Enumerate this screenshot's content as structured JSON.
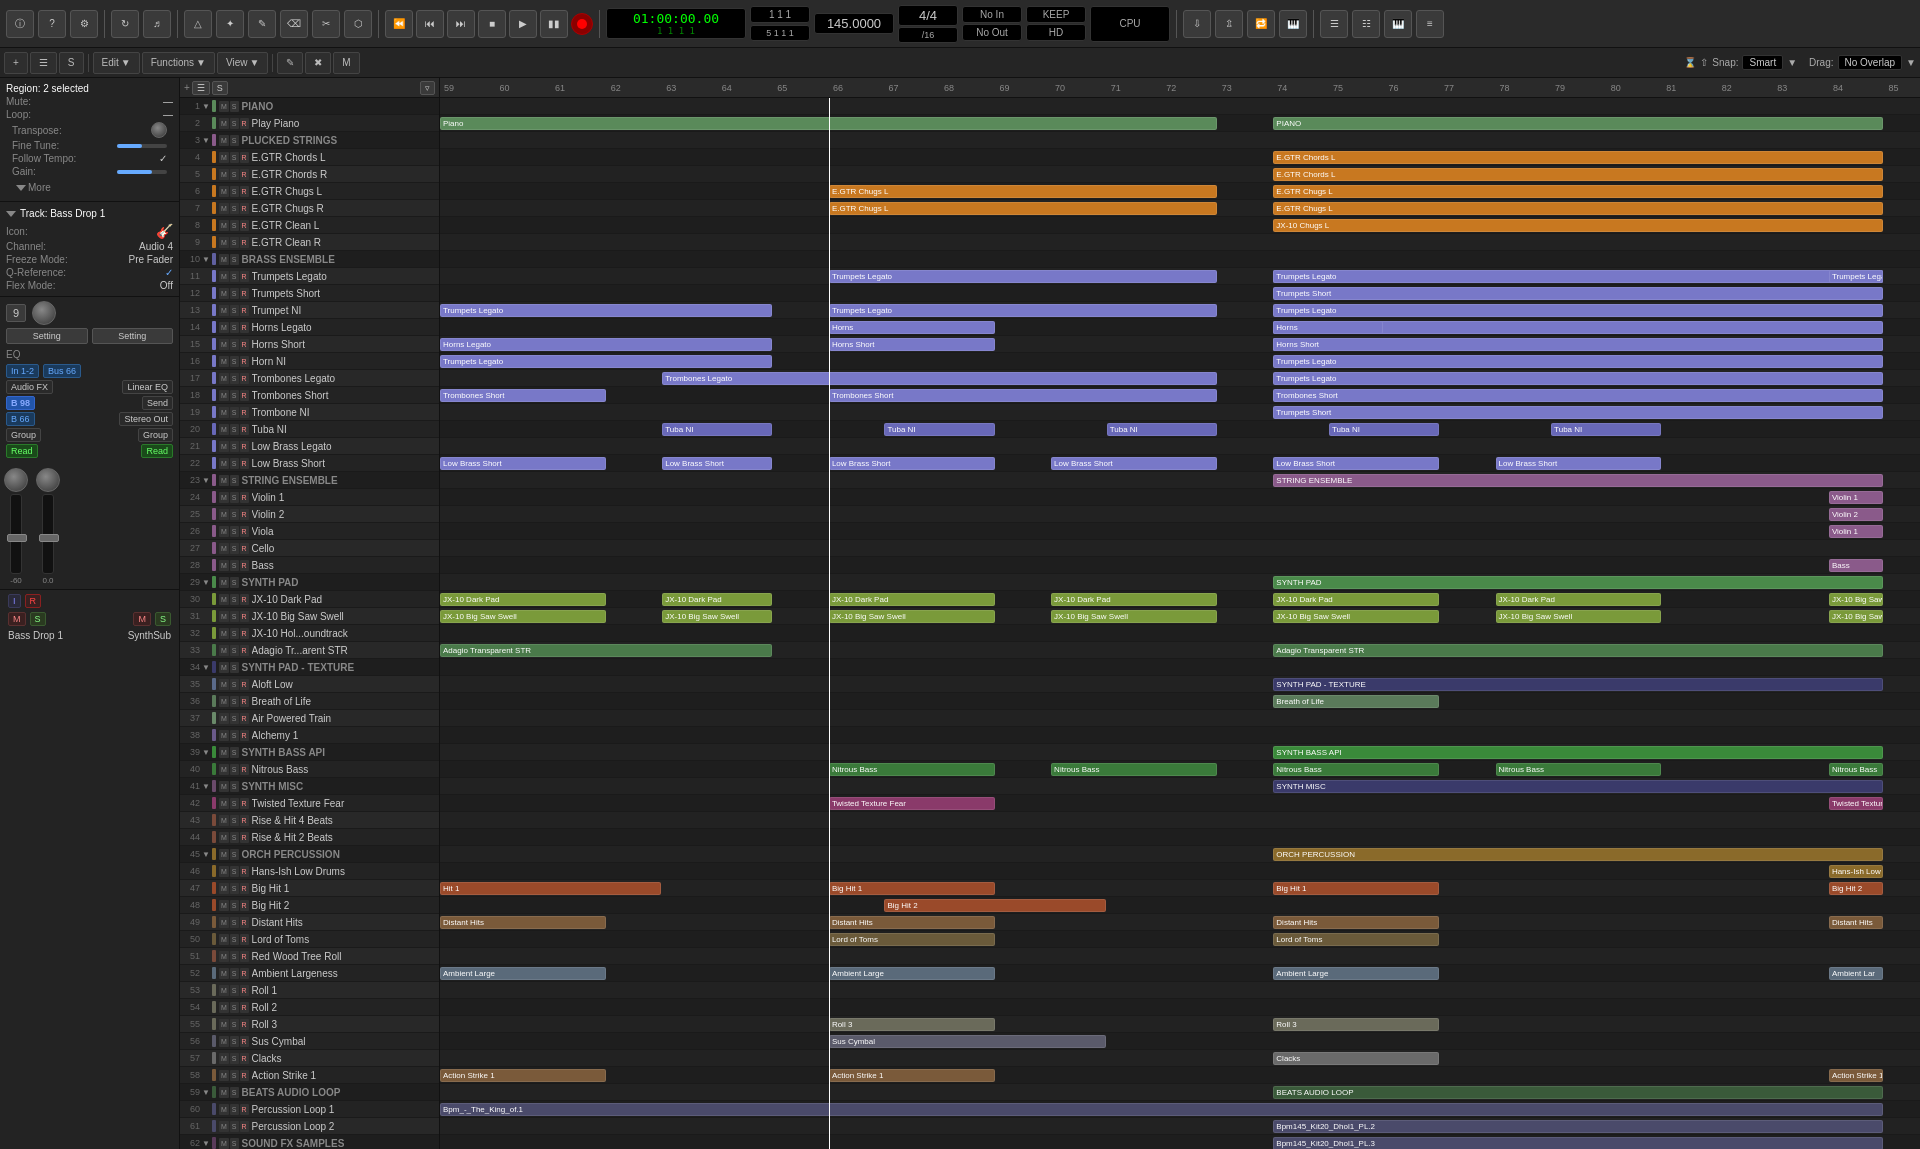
{
  "toolbar": {
    "time": "01:00:00.00",
    "time_sub": "1  1  1  1",
    "beats": "1  1  1",
    "beats_sub": "5  1  1  1",
    "tempo": "145.0000",
    "sig": "4/4",
    "division": "/16",
    "no_in": "No In",
    "no_out": "No Out",
    "keep": "KEEP",
    "hd": "HD",
    "cpu": "CPU",
    "buttons": [
      "info",
      "help",
      "config",
      "loop",
      "metronome",
      "cursor",
      "smart",
      "pen",
      "eraser",
      "cut",
      "glue",
      "select",
      "zoom",
      "fade"
    ],
    "transport": [
      "rewind",
      "back",
      "forward",
      "stop",
      "play",
      "pause",
      "record"
    ]
  },
  "edit_toolbar": {
    "edit": "Edit",
    "functions": "Functions",
    "view": "View",
    "snap": "Snap:",
    "snap_val": "Smart",
    "drag": "Drag:",
    "drag_val": "No Overlap"
  },
  "left_panel": {
    "region_label": "Region: 2 selected",
    "mute": "Mute:",
    "loop": "Loop:",
    "transpose": "Transpose:",
    "fine_tune": "Fine Tune:",
    "follow_tempo": "Follow Tempo:",
    "gain": "Gain:",
    "more": "More",
    "track_label": "Track: Bass Drop 1",
    "icon_label": "guitar",
    "channel": "Channel: Audio 4",
    "freeze_mode": "Freeze Mode: Pre Fader",
    "q_reference": "Q-Reference:",
    "flex_mode": "Flex Mode: Off",
    "channel_num": "9",
    "setting1": "Setting",
    "setting2": "Setting",
    "eq": "EQ",
    "in_bus": "In 1-2",
    "bus_num": "Bus 66",
    "audio_fx": "Audio FX",
    "linear_eq": "Linear EQ",
    "b_num": "B 98",
    "send": "Send",
    "b66": "B 66",
    "stereo_out": "Stereo Out",
    "group": "Group",
    "group2": "Group",
    "read": "Read",
    "read2": "Read",
    "fader_val": "-60",
    "pan_val": "0.0",
    "msil_i": "I",
    "msil_r": "R",
    "msil_m": "M",
    "msil_s": "S",
    "msil_m2": "M",
    "msil_s2": "S",
    "bottom_name": "Bass Drop 1",
    "synth_sub": "SynthSub"
  },
  "tracks": [
    {
      "num": 1,
      "name": "PIANO",
      "color": "#5a8a5a",
      "is_section": true,
      "has_arrow": false
    },
    {
      "num": 2,
      "name": "Play Piano",
      "color": "#5a8a5a",
      "is_section": false,
      "has_arrow": false
    },
    {
      "num": 3,
      "name": "PLUCKED STRINGS",
      "color": "#8a5a8a",
      "is_section": true,
      "has_arrow": false
    },
    {
      "num": 4,
      "name": "E.GTR Chords L",
      "color": "#c87820",
      "is_section": false
    },
    {
      "num": 5,
      "name": "E.GTR Chords R",
      "color": "#c87820",
      "is_section": false
    },
    {
      "num": 6,
      "name": "E.GTR Chugs L",
      "color": "#c87820",
      "is_section": false
    },
    {
      "num": 7,
      "name": "E.GTR Chugs R",
      "color": "#c87820",
      "is_section": false
    },
    {
      "num": 8,
      "name": "E.GTR Clean L",
      "color": "#c87820",
      "is_section": false
    },
    {
      "num": 9,
      "name": "E.GTR Clean R",
      "color": "#c87820",
      "is_section": false
    },
    {
      "num": 10,
      "name": "BRASS ENSEMBLE",
      "color": "#6060a0",
      "is_section": true,
      "has_arrow": false
    },
    {
      "num": 11,
      "name": "Trumpets Legato",
      "color": "#7878c8",
      "is_section": false
    },
    {
      "num": 12,
      "name": "Trumpets Short",
      "color": "#7878c8",
      "is_section": false
    },
    {
      "num": 13,
      "name": "Trumpet NI",
      "color": "#7878c8",
      "is_section": false
    },
    {
      "num": 14,
      "name": "Horns Legato",
      "color": "#7878c8",
      "is_section": false
    },
    {
      "num": 15,
      "name": "Horns Short",
      "color": "#7878c8",
      "is_section": false
    },
    {
      "num": 16,
      "name": "Horn NI",
      "color": "#7878c8",
      "is_section": false
    },
    {
      "num": 17,
      "name": "Trombones Legato",
      "color": "#7878c8",
      "is_section": false
    },
    {
      "num": 18,
      "name": "Trombones Short",
      "color": "#7878c8",
      "is_section": false
    },
    {
      "num": 19,
      "name": "Trombone NI",
      "color": "#7878c8",
      "is_section": false
    },
    {
      "num": 20,
      "name": "Tuba NI",
      "color": "#6868b8",
      "is_section": false
    },
    {
      "num": 21,
      "name": "Low Brass Legato",
      "color": "#7878c8",
      "is_section": false
    },
    {
      "num": 22,
      "name": "Low Brass Short",
      "color": "#7878c8",
      "is_section": false
    },
    {
      "num": 23,
      "name": "STRING ENSEMBLE",
      "color": "#8a5a8a",
      "is_section": true
    },
    {
      "num": 24,
      "name": "Violin 1",
      "color": "#8a5a8a",
      "is_section": false
    },
    {
      "num": 25,
      "name": "Violin 2",
      "color": "#8a5a8a",
      "is_section": false
    },
    {
      "num": 26,
      "name": "Viola",
      "color": "#8a5a8a",
      "is_section": false
    },
    {
      "num": 27,
      "name": "Cello",
      "color": "#8a5a8a",
      "is_section": false
    },
    {
      "num": 28,
      "name": "Bass",
      "color": "#8a5a8a",
      "is_section": false
    },
    {
      "num": 29,
      "name": "SYNTH PAD",
      "color": "#4a8a4a",
      "is_section": true
    },
    {
      "num": 30,
      "name": "JX-10 Dark Pad",
      "color": "#7a9a3a",
      "is_section": false
    },
    {
      "num": 31,
      "name": "JX-10 Big Saw Swell",
      "color": "#7a9a3a",
      "is_section": false
    },
    {
      "num": 32,
      "name": "JX-10 Hol...oundtrack",
      "color": "#7a9a3a",
      "is_section": false
    },
    {
      "num": 33,
      "name": "Adagio Tr...arent STR",
      "color": "#4a7a4a",
      "is_section": false
    },
    {
      "num": 34,
      "name": "SYNTH PAD - TEXTURE",
      "color": "#3a3a6a",
      "is_section": true
    },
    {
      "num": 35,
      "name": "Aloft Low",
      "color": "#5a6a8a",
      "is_section": false
    },
    {
      "num": 36,
      "name": "Breath of Life",
      "color": "#5a7a5a",
      "is_section": false
    },
    {
      "num": 37,
      "name": "Air Powered Train",
      "color": "#6a8a6a",
      "is_section": false
    },
    {
      "num": 38,
      "name": "Alchemy 1",
      "color": "#6a5a8a",
      "is_section": false
    },
    {
      "num": 39,
      "name": "SYNTH BASS API",
      "color": "#3a8a3a",
      "is_section": true
    },
    {
      "num": 40,
      "name": "Nitrous Bass",
      "color": "#3a7a3a",
      "is_section": false
    },
    {
      "num": 41,
      "name": "SYNTH MISC",
      "color": "#6a4a6a",
      "is_section": true
    },
    {
      "num": 42,
      "name": "Twisted Texture Fear",
      "color": "#8a3a6a",
      "is_section": false
    },
    {
      "num": 43,
      "name": "Rise & Hit 4 Beats",
      "color": "#7a4a3a",
      "is_section": false
    },
    {
      "num": 44,
      "name": "Rise & Hit 2 Beats",
      "color": "#7a4a3a",
      "is_section": false
    },
    {
      "num": 45,
      "name": "ORCH PERCUSSION",
      "color": "#8a6a2a",
      "is_section": true
    },
    {
      "num": 46,
      "name": "Hans-Ish Low Drums",
      "color": "#8a6a2a",
      "is_section": false
    },
    {
      "num": 47,
      "name": "Big Hit 1",
      "color": "#9a4a2a",
      "is_section": false
    },
    {
      "num": 48,
      "name": "Big Hit 2",
      "color": "#9a4a2a",
      "is_section": false
    },
    {
      "num": 49,
      "name": "Distant Hits",
      "color": "#7a5a3a",
      "is_section": false
    },
    {
      "num": 50,
      "name": "Lord of Toms",
      "color": "#6a5a3a",
      "is_section": false
    },
    {
      "num": 51,
      "name": "Red Wood Tree Roll",
      "color": "#7a4a3a",
      "is_section": false
    },
    {
      "num": 52,
      "name": "Ambient Largeness",
      "color": "#5a6a7a",
      "is_section": false
    },
    {
      "num": 53,
      "name": "Roll 1",
      "color": "#6a6a5a",
      "is_section": false
    },
    {
      "num": 54,
      "name": "Roll 2",
      "color": "#6a6a5a",
      "is_section": false
    },
    {
      "num": 55,
      "name": "Roll 3",
      "color": "#6a6a5a",
      "is_section": false
    },
    {
      "num": 56,
      "name": "Sus Cymbal",
      "color": "#5a5a6a",
      "is_section": false
    },
    {
      "num": 57,
      "name": "Clacks",
      "color": "#6a6a6a",
      "is_section": false
    },
    {
      "num": 58,
      "name": "Action Strike 1",
      "color": "#7a5a3a",
      "is_section": false
    },
    {
      "num": 59,
      "name": "BEATS AUDIO LOOP",
      "color": "#3a5a3a",
      "is_section": true
    },
    {
      "num": 60,
      "name": "Percussion Loop 1",
      "color": "#4a4a6a",
      "is_section": false
    },
    {
      "num": 61,
      "name": "Percussion Loop 2",
      "color": "#4a4a6a",
      "is_section": false
    },
    {
      "num": 62,
      "name": "SOUND FX SAMPLES",
      "color": "#5a3a5a",
      "is_section": true
    }
  ],
  "timeline_numbers": [
    59,
    60,
    61,
    62,
    63,
    64,
    65,
    66,
    67,
    68,
    69,
    70,
    71,
    72,
    73,
    74,
    75,
    76,
    77,
    78,
    79,
    80,
    81,
    82,
    83,
    84,
    85
  ]
}
